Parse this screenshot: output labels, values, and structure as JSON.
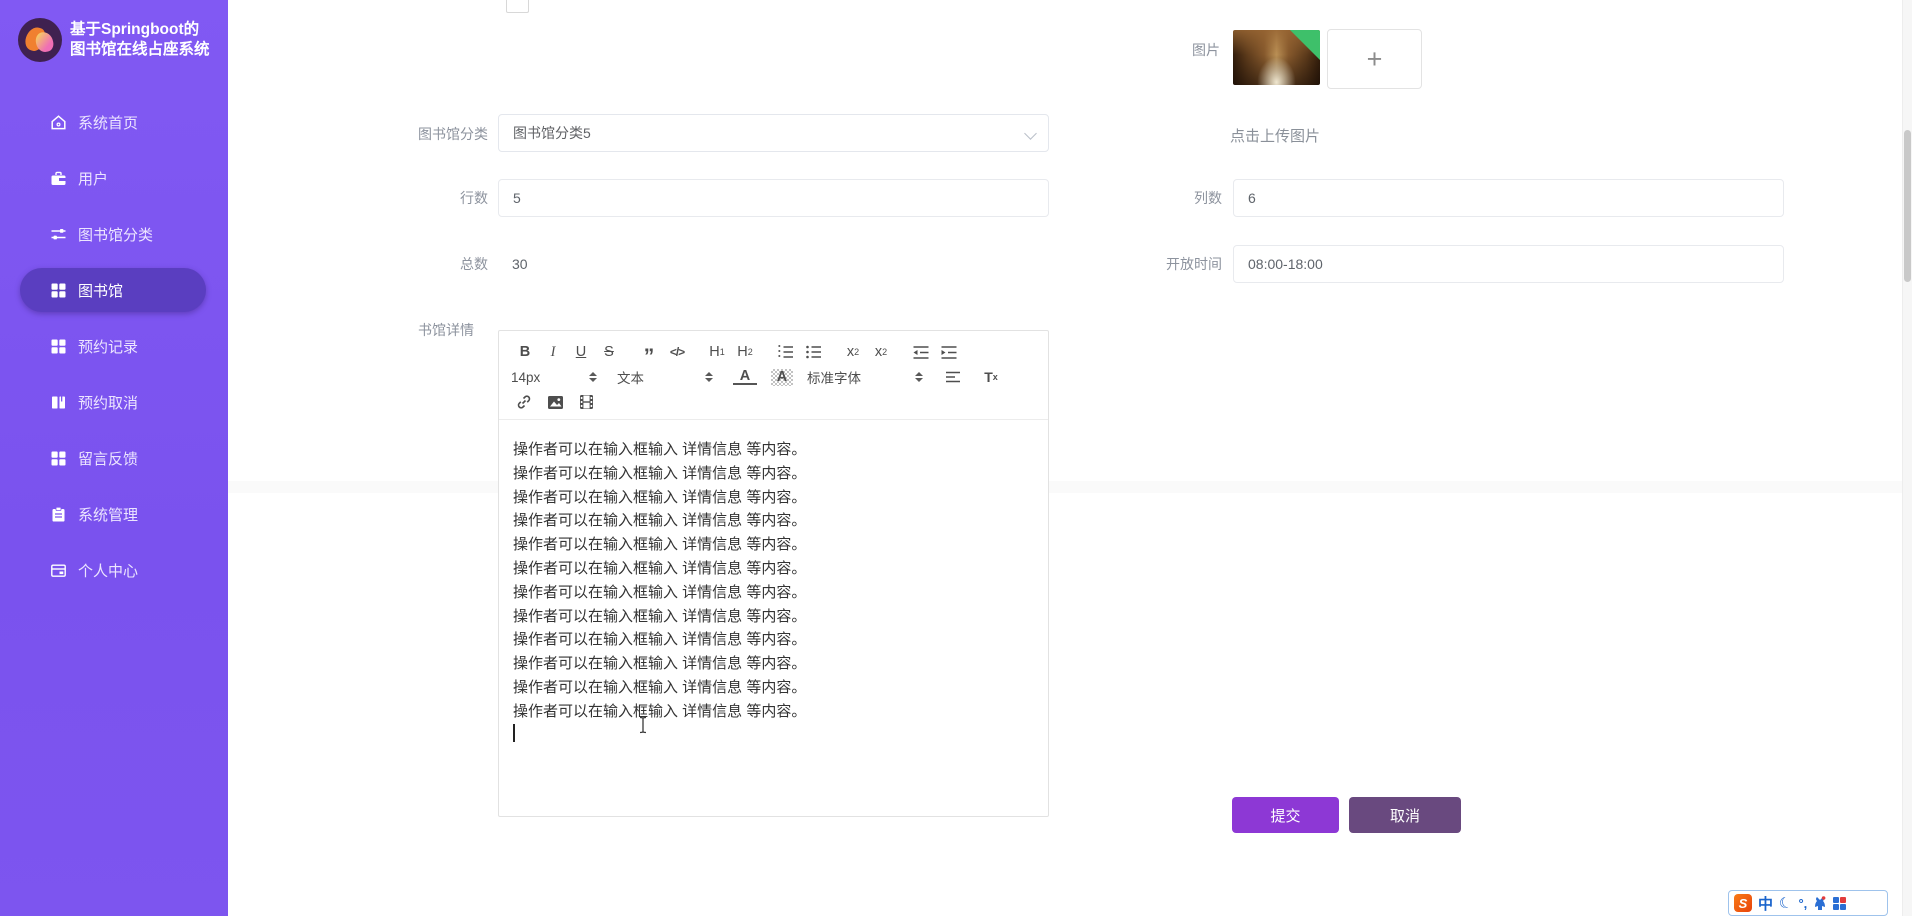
{
  "app": {
    "title_line1": "基于Springboot的",
    "title_line2": "图书馆在线占座系统"
  },
  "sidebar": {
    "items": [
      {
        "label": "系统首页",
        "icon": "home-icon",
        "active": false
      },
      {
        "label": "用户",
        "icon": "briefcase-icon",
        "active": false
      },
      {
        "label": "图书馆分类",
        "icon": "sliders-icon",
        "active": false
      },
      {
        "label": "图书馆",
        "icon": "grid-icon",
        "active": true
      },
      {
        "label": "预约记录",
        "icon": "grid-icon",
        "active": false
      },
      {
        "label": "预约取消",
        "icon": "book-icon",
        "active": false
      },
      {
        "label": "留言反馈",
        "icon": "grid-icon",
        "active": false
      },
      {
        "label": "系统管理",
        "icon": "clipboard-icon",
        "active": false
      },
      {
        "label": "个人中心",
        "icon": "card-icon",
        "active": false
      }
    ]
  },
  "form": {
    "image_label": "图片",
    "upload_plus": "+",
    "upload_hint": "点击上传图片",
    "category_label": "图书馆分类",
    "category_value": "图书馆分类5",
    "rows_label": "行数",
    "rows_value": "5",
    "cols_label": "列数",
    "cols_value": "6",
    "total_label": "总数",
    "total_value": "30",
    "open_time_label": "开放时间",
    "open_time_value": "08:00-18:00",
    "detail_label": "书馆详情"
  },
  "editor": {
    "toolbar": {
      "bold": "B",
      "italic": "I",
      "underline": "U",
      "strike": "S",
      "quote": "”",
      "code": "</>",
      "h": "H",
      "h1_sub": "1",
      "h2_sub": "2",
      "x": "x",
      "sub_n": "2",
      "sup_n": "2",
      "font_size": "14px",
      "text_type": "文本",
      "color_letter": "A",
      "highlight_letter": "A",
      "font_family": "标准字体",
      "clear_t": "T",
      "clear_x": "x"
    },
    "lines": [
      "操作者可以在输入框输入 详情信息 等内容。",
      "操作者可以在输入框输入 详情信息 等内容。",
      "操作者可以在输入框输入 详情信息 等内容。",
      "操作者可以在输入框输入 详情信息 等内容。",
      "操作者可以在输入框输入 详情信息 等内容。",
      "操作者可以在输入框输入 详情信息 等内容。",
      "操作者可以在输入框输入 详情信息 等内容。",
      "操作者可以在输入框输入 详情信息 等内容。",
      "操作者可以在输入框输入 详情信息 等内容。",
      "操作者可以在输入框输入 详情信息 等内容。",
      "操作者可以在输入框输入 详情信息 等内容。",
      "操作者可以在输入框输入 详情信息 等内容。"
    ]
  },
  "actions": {
    "submit": "提交",
    "cancel": "取消"
  },
  "ime": {
    "logo": "S",
    "lang": "中",
    "moon": "☾",
    "punct": "°,"
  },
  "colors": {
    "sidebar_purple": "#7d55ef",
    "sidebar_active": "#5a3ec0",
    "submit_purple": "#8d38d5",
    "cancel_purple": "#69497f",
    "upload_badge_green": "#3ec06a"
  }
}
